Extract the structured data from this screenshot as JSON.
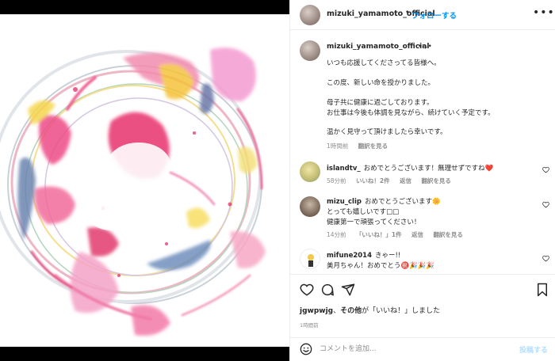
{
  "post": {
    "image_alt": "Colorful abstract circular paint artwork"
  },
  "header": {
    "username": "mizuki_yamamoto_official",
    "dot": "•",
    "follow_label": "フォローする",
    "more_icon": "more-horizontal-icon"
  },
  "caption": {
    "username": "mizuki_yamamoto_official",
    "suffix": "•ᵕ⸝•",
    "lines": [
      "いつも応援してくださってる皆様へ。",
      "この度、新しい命を授かりました。",
      "母子共に健康に過ごしております。",
      "お仕事は今後も体調を見ながら、続けていく予定です。",
      "温かく見守って頂けましたら幸いです。"
    ],
    "time": "1時間前",
    "translate": "翻訳を見る"
  },
  "comments": [
    {
      "username": "islandtv_",
      "text_lines": [
        "おめでとうございます！無理せずですね❤️"
      ],
      "time": "58分前",
      "likes": "いいね！2件",
      "reply": "返信",
      "translate": "翻訳を見る"
    },
    {
      "username": "mizu_clip",
      "text_lines": [
        "おめでとうございます🌼",
        "とっても嬉しいです□□",
        "健康第一で頑張ってください！"
      ],
      "time": "14分前",
      "likes": "「いいね！」1件",
      "reply": "返信",
      "translate": "翻訳を見る"
    },
    {
      "username": "mifune2014",
      "text_lines": [
        "きゃー!!",
        "美月ちゃん！おめでとう㊗️🎉🎉🎉"
      ],
      "time": "",
      "likes": "",
      "reply": "",
      "translate": ""
    }
  ],
  "likes_line": {
    "user": "jgwpwjg",
    "sep": "、",
    "others": "その他",
    "rest": "が「いいね！」しました"
  },
  "posted_time": "1時間前",
  "add_comment": {
    "placeholder": "コメントを追加...",
    "post_label": "投稿する"
  },
  "colors": {
    "accent": "#0095f6",
    "muted": "#8e8e8e",
    "post_disabled": "#b2dffc",
    "heart_red": "#ed4956"
  }
}
